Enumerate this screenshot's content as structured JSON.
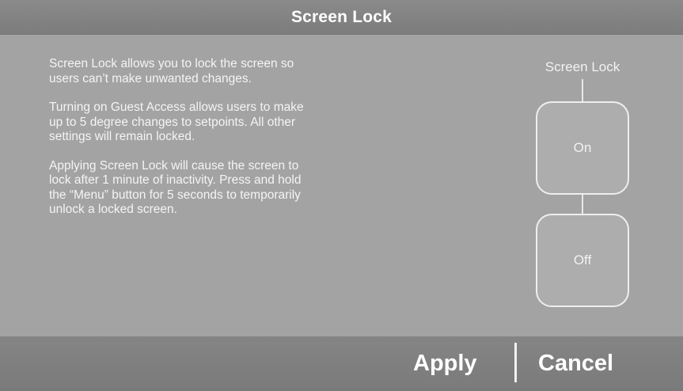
{
  "header": {
    "title": "Screen Lock"
  },
  "description": {
    "paragraph1": "Screen Lock allows you to lock the screen so users can’t make unwanted changes.",
    "paragraph2": "Turning on Guest Access allows users to make up to 5 degree changes to setpoints. All other settings will remain locked.",
    "paragraph3": "Applying Screen Lock will cause the screen to lock after 1 minute of inactivity. Press and hold the “Menu” button for 5 seconds to temporarily unlock a locked screen."
  },
  "screen_lock": {
    "label": "Screen Lock",
    "options": [
      {
        "label": "On"
      },
      {
        "label": "Off"
      }
    ]
  },
  "footer": {
    "apply_label": "Apply",
    "cancel_label": "Cancel"
  },
  "colors": {
    "title_text": "#ffffff",
    "background": "#a3a3a3",
    "bar": "#7f7f7f"
  }
}
